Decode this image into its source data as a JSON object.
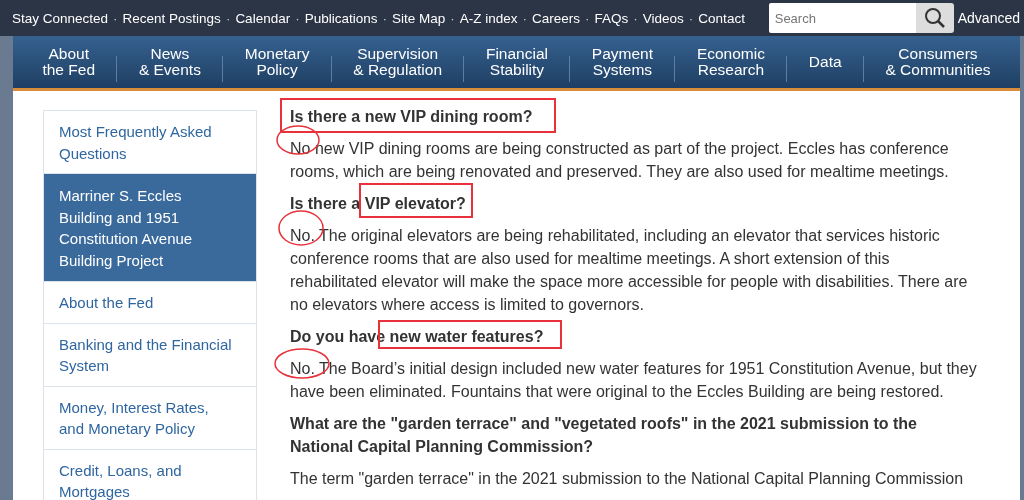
{
  "utility_links": {
    "separator": "·",
    "items": [
      "Stay Connected",
      "Recent Postings",
      "Calendar",
      "Publications",
      "Site Map",
      "A-Z index",
      "Careers",
      "FAQs",
      "Videos",
      "Contact"
    ]
  },
  "search": {
    "placeholder": "Search",
    "advanced": "Advanced"
  },
  "main_nav": [
    {
      "line1": "About",
      "line2": "the Fed"
    },
    {
      "line1": "News",
      "line2": "& Events"
    },
    {
      "line1": "Monetary",
      "line2": "Policy"
    },
    {
      "line1": "Supervision",
      "line2": "& Regulation"
    },
    {
      "line1": "Financial",
      "line2": "Stability"
    },
    {
      "line1": "Payment",
      "line2": "Systems"
    },
    {
      "line1": "Economic",
      "line2": "Research"
    },
    {
      "line1": "Data"
    },
    {
      "line1": "Consumers",
      "line2": "& Communities"
    }
  ],
  "sidebar": {
    "items": [
      {
        "label": "Most Frequently Asked Questions",
        "selected": false
      },
      {
        "label": "Marriner S. Eccles Building and 1951 Constitution Avenue Building Project",
        "selected": true
      },
      {
        "label": "About the Fed",
        "selected": false
      },
      {
        "label": "Banking and the Financial System",
        "selected": false
      },
      {
        "label": "Money, Interest Rates, and Monetary Policy",
        "selected": false
      },
      {
        "label": "Credit, Loans, and Mortgages",
        "selected": false
      }
    ]
  },
  "faq": [
    {
      "question": "Is there a new VIP dining room?",
      "boxed": true,
      "answer": "No new VIP dining rooms are being constructed as part of the project. Eccles has conference rooms, which are being renovated and preserved. They are also used for mealtime meetings.",
      "circled": true
    },
    {
      "question": "Is there a VIP elevator?",
      "boxed": true,
      "answer": "No. The original elevators are being rehabilitated, including an elevator that services historic conference rooms that are also used for mealtime meetings. A short extension of this rehabilitated elevator will make the space more accessible for people with disabilities. There are no elevators where access is limited to governors.",
      "circled": true
    },
    {
      "question": "Do you have new water features?",
      "boxed": true,
      "answer": "No. The Board’s initial design included new water features for 1951 Constitution Avenue, but they have been eliminated. Fountains that were original to the Eccles Building are being restored.",
      "circled": true
    },
    {
      "question": "What are the \"garden terrace\" and \"vegetated roofs\" in the 2021 submission to the National Capital Planning Commission?",
      "boxed": false,
      "answer": "The term \"garden terrace\" in the 2021 submission to the National Capital Planning Commission",
      "circled": false
    }
  ]
}
